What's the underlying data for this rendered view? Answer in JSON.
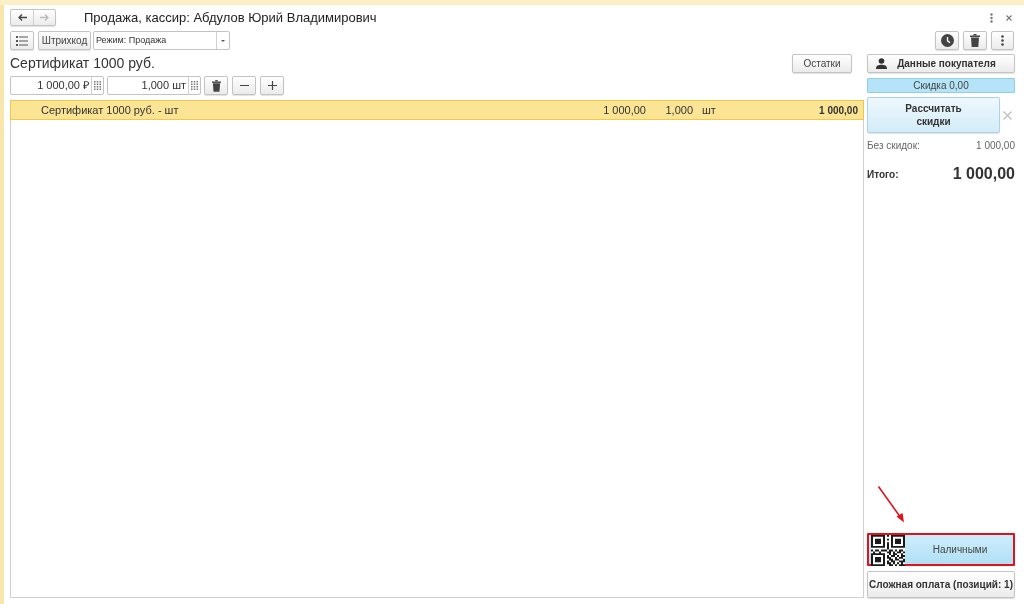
{
  "window": {
    "title": "Продажа, кассир: Абдулов Юрий Владимирович",
    "navigation": [
      {
        "kind": "back",
        "disabled": false
      },
      {
        "kind": "forward",
        "disabled": true
      }
    ]
  },
  "toolbar": {
    "barcode_button": "Штрихкод",
    "mode_select": {
      "value": "Режим: Продажа"
    }
  },
  "product": {
    "name": "Сертификат 1000 руб.",
    "price": "1 000,00 ₽",
    "quantity": "1,000 шт",
    "stock_button": "Остатки"
  },
  "table": {
    "rows": [
      {
        "name": "Сертификат 1000 руб. - шт",
        "price": "1 000,00",
        "quantity": "1,000",
        "unit": "шт",
        "sum": "1 000,00",
        "selected": true
      }
    ]
  },
  "sidebar": {
    "customer_button": "Данные покупателя",
    "discount": "Скидка 0,00",
    "calculate_button": "Рассчитать скидки",
    "without_discounts": {
      "label": "Без скидок:",
      "value": "1 000,00"
    },
    "total": {
      "label": "Итого:",
      "value": "1 000,00"
    },
    "payment_buttons": [
      {
        "label": "Наличными",
        "kind": "cash",
        "highlighted": true
      },
      {
        "label": "Сложная оплата (позиций: 1)",
        "kind": "complex",
        "highlighted": false
      }
    ]
  }
}
